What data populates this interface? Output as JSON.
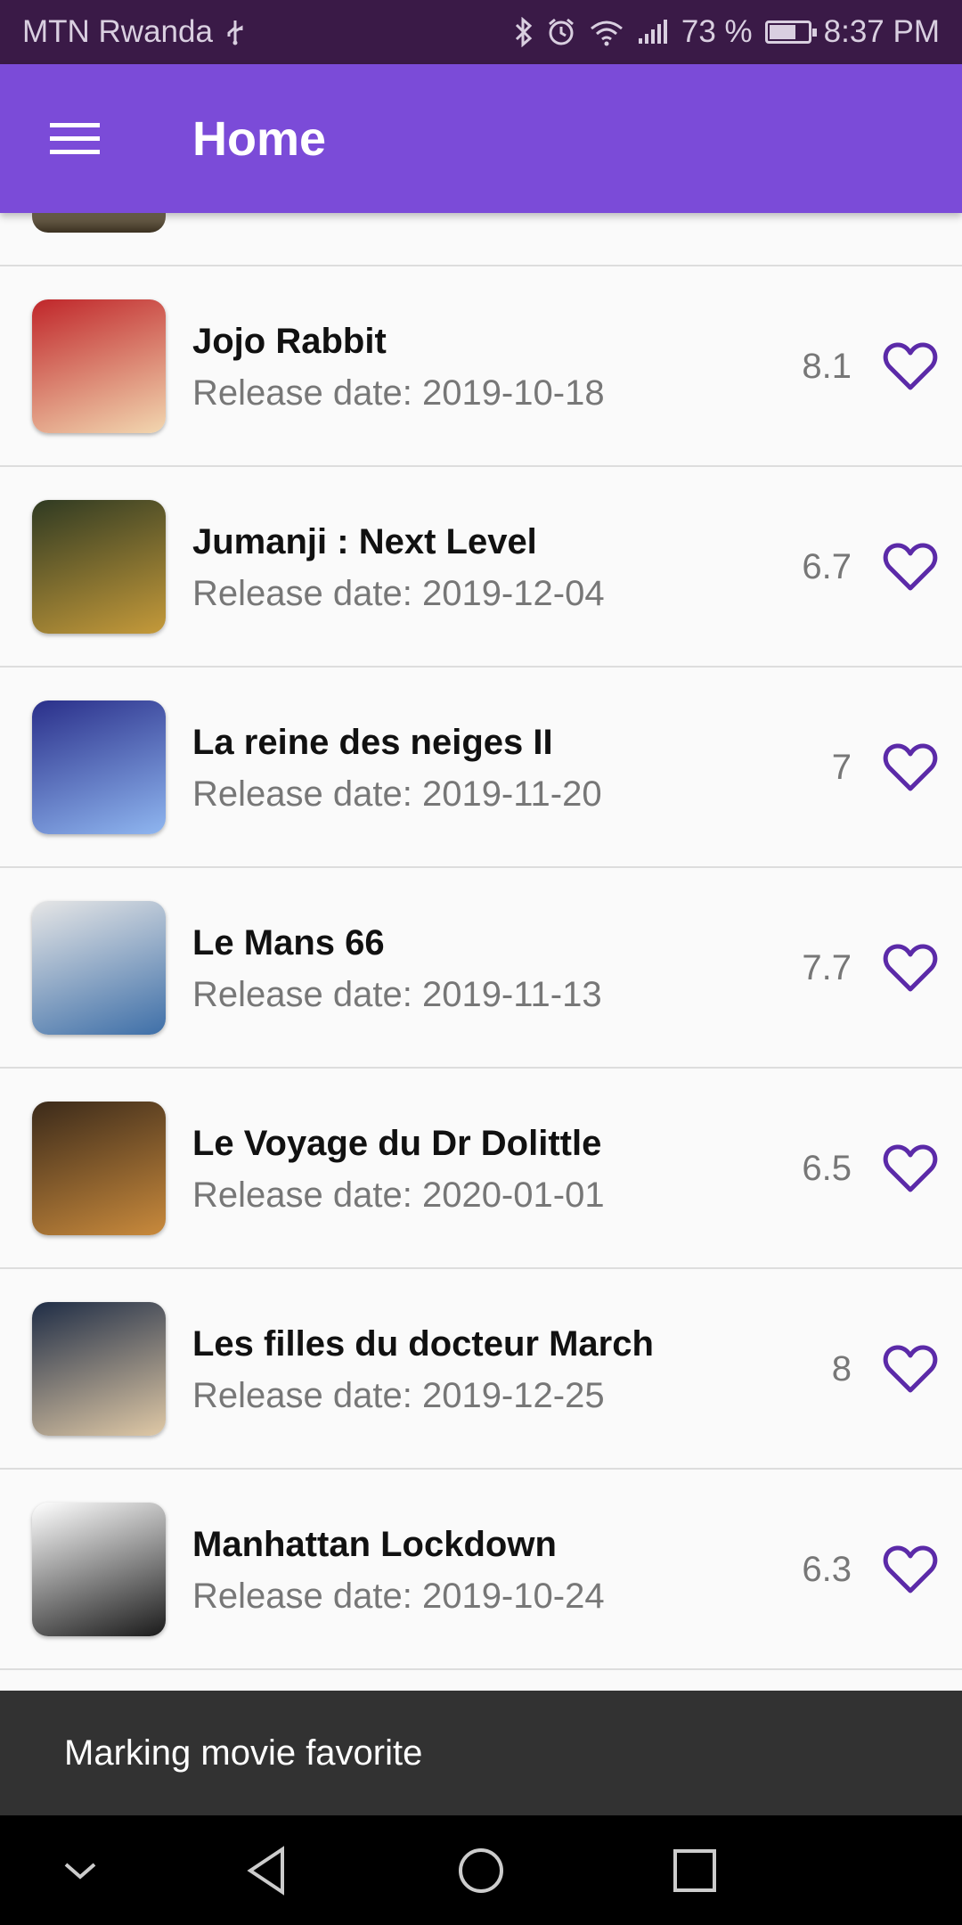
{
  "status_bar": {
    "carrier": "MTN Rwanda",
    "battery": "73 %",
    "time": "8:37 PM",
    "battery_level": 0.73
  },
  "app_bar": {
    "title": "Home",
    "menu_icon": "hamburger-menu-icon"
  },
  "movies": [
    {
      "title": "Jojo Rabbit",
      "release": "Release date: 2019-10-18",
      "rating": "8.1",
      "poster_colors": [
        "#c0262a",
        "#f2d7b0"
      ]
    },
    {
      "title": "Jumanji : Next Level",
      "release": "Release date: 2019-12-04",
      "rating": "6.7",
      "poster_colors": [
        "#2f3a22",
        "#c59a3a"
      ]
    },
    {
      "title": "La reine des neiges II",
      "release": "Release date: 2019-11-20",
      "rating": "7",
      "poster_colors": [
        "#2a2f8a",
        "#8fb6f0"
      ]
    },
    {
      "title": "Le Mans 66",
      "release": "Release date: 2019-11-13",
      "rating": "7.7",
      "poster_colors": [
        "#e6e6e6",
        "#3e6fa8"
      ]
    },
    {
      "title": "Le Voyage du Dr Dolittle",
      "release": "Release date: 2020-01-01",
      "rating": "6.5",
      "poster_colors": [
        "#3b2a1a",
        "#c98a3c"
      ]
    },
    {
      "title": "Les filles du docteur March",
      "release": "Release date: 2019-12-25",
      "rating": "8",
      "poster_colors": [
        "#1f2d46",
        "#e0c9a6"
      ]
    },
    {
      "title": "Manhattan Lockdown",
      "release": "Release date: 2019-10-24",
      "rating": "6.3",
      "poster_colors": [
        "#ffffff",
        "#1a1a1a"
      ]
    }
  ],
  "snackbar": {
    "message": "Marking movie favorite"
  },
  "colors": {
    "primary": "#7b4bd8",
    "status_bar": "#3a1a47",
    "heart": "#5b2aa8"
  },
  "nav_bar": {
    "icons": [
      "chevron-down-icon",
      "back-icon",
      "home-icon",
      "recents-icon"
    ]
  }
}
